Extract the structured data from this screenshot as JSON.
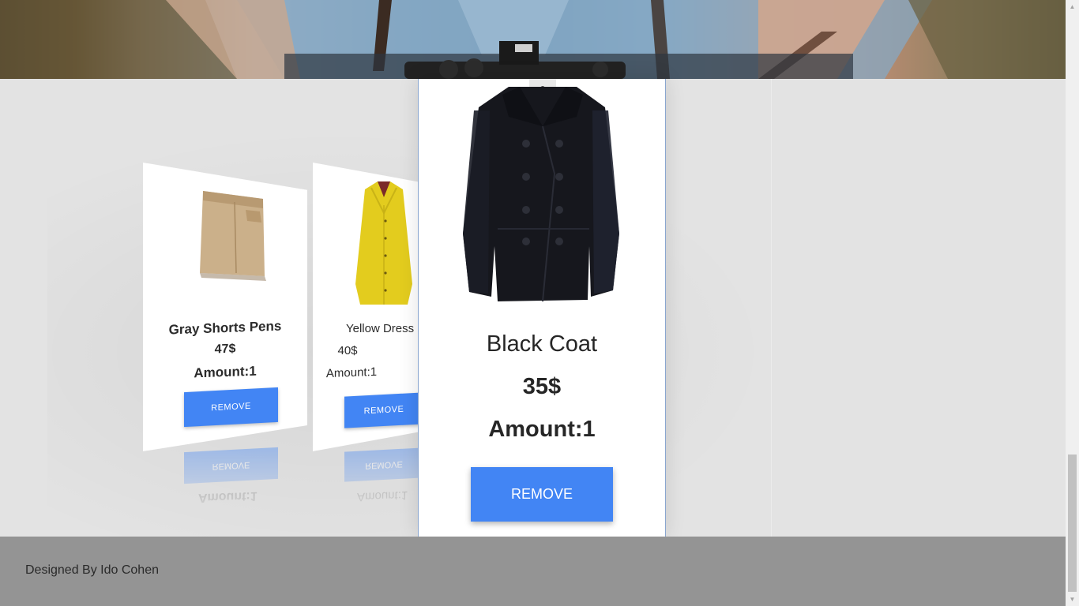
{
  "footer": {
    "credit": "Designed By Ido Cohen"
  },
  "cart": {
    "items": [
      {
        "name": "Gray Shorts Pens",
        "price": "47$",
        "amount": "Amount:1",
        "remove_label": "REMOVE",
        "image_icon": "khaki-shorts-icon"
      },
      {
        "name": "Yellow Dress",
        "price": "40$",
        "amount": "Amount:1",
        "remove_label": "REMOVE",
        "image_icon": "yellow-coat-icon"
      },
      {
        "name": "Black Coat",
        "price": "35$",
        "amount": "Amount:1",
        "remove_label": "REMOVE",
        "image_icon": "black-peacoat-icon"
      }
    ],
    "active_index": 2
  },
  "colors": {
    "accent": "#4285f4",
    "footer_bg": "#949494",
    "page_bg": "#e3e3e3"
  },
  "scrollbar": {
    "up_icon": "scroll-up-arrow-icon",
    "down_icon": "scroll-down-arrow-icon"
  }
}
